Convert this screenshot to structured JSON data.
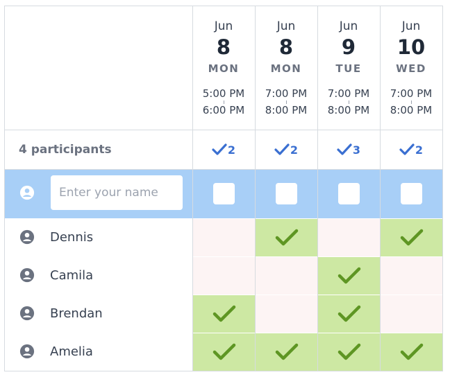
{
  "name_input": {
    "placeholder": "Enter your name"
  },
  "summary": {
    "label": "4 participants"
  },
  "options": [
    {
      "month": "Jun",
      "day": "8",
      "dow": "MON",
      "start": "5:00 PM",
      "end": "6:00 PM",
      "count": "2"
    },
    {
      "month": "Jun",
      "day": "8",
      "dow": "MON",
      "start": "7:00 PM",
      "end": "8:00 PM",
      "count": "2"
    },
    {
      "month": "Jun",
      "day": "9",
      "dow": "TUE",
      "start": "7:00 PM",
      "end": "8:00 PM",
      "count": "3"
    },
    {
      "month": "Jun",
      "day": "10",
      "dow": "WED",
      "start": "7:00 PM",
      "end": "8:00 PM",
      "count": "2"
    }
  ],
  "participants": [
    {
      "name": "Dennis",
      "votes": [
        false,
        true,
        false,
        true
      ]
    },
    {
      "name": "Camila",
      "votes": [
        false,
        false,
        true,
        false
      ]
    },
    {
      "name": "Brendan",
      "votes": [
        true,
        false,
        true,
        false
      ]
    },
    {
      "name": "Amelia",
      "votes": [
        true,
        true,
        true,
        true
      ]
    }
  ],
  "colors": {
    "accent": "#3a6fd1",
    "selected_row": "#a8cff7",
    "yes": "#cde8a3",
    "no": "#fdf4f4",
    "check": "#5e9623"
  },
  "icons": {
    "participant": "user-circle-icon",
    "count": "check-icon",
    "vote": "check-icon"
  }
}
